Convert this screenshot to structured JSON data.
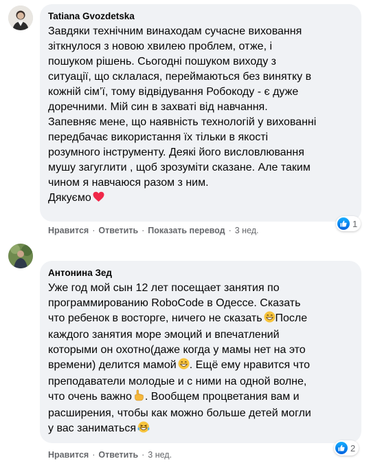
{
  "comments": [
    {
      "author": "Tatiana Gvozdetska",
      "lines": [
        "Завдяки технічним винаходам сучасне виховання",
        "зіткнулося з новою хвилею проблем, отже, і",
        "пошуком рішень. Сьогодні пошуком виходу з",
        "ситуації, що склалася, переймаються без винятку в",
        "кожній сім’ї, тому відвідування Робокоду - є дуже",
        "доречними. Мій син в захваті від навчання.",
        "Запевняє мене, що наявність технологій у вихованні",
        "передбачає використання їх тільки в якості",
        "розумного інструменту. Деякі його висловлювання",
        "мушу загуглити , щоб зрозуміти сказане. Але таким",
        "чином я навчаюся разом з ним.",
        "Дякуємо"
      ],
      "actions": {
        "like": "Нравится",
        "reply": "Ответить",
        "translate": "Показать перевод",
        "time": "3 нед."
      },
      "reaction_count": "1"
    },
    {
      "author": "Антонина Зед",
      "lines": [
        "Уже год мой сын 12 лет посещает занятия по",
        "программированию RoboCode в Одессе. Сказать",
        "что ребенок в восторге, ничего не сказать",
        "После",
        "каждого занятия море эмоций и впечатлений",
        "которыми он охотно(даже когда у мамы нет на это",
        "времени) делится мамой",
        ". Ещё ему нравится что",
        "преподаватели молодые и с ними на одной волне,",
        "что очень важно",
        ". Вообщем процветания вам и",
        "расширения, чтобы как можно больше детей могли",
        "у вас заниматься"
      ],
      "actions": {
        "like": "Нравится",
        "reply": "Ответить",
        "time": "3 нед."
      },
      "reaction_count": "2"
    }
  ],
  "colors": {
    "bubble": "#f0f2f5",
    "meta_text": "#65676b",
    "like_blue": "#1877f2",
    "heart_red": "#f02849"
  },
  "icons": [
    "heart-emoji",
    "grin-emoji",
    "grin-emoji",
    "pointing-hand-emoji",
    "laughing-emoji",
    "like-reaction-icon"
  ]
}
